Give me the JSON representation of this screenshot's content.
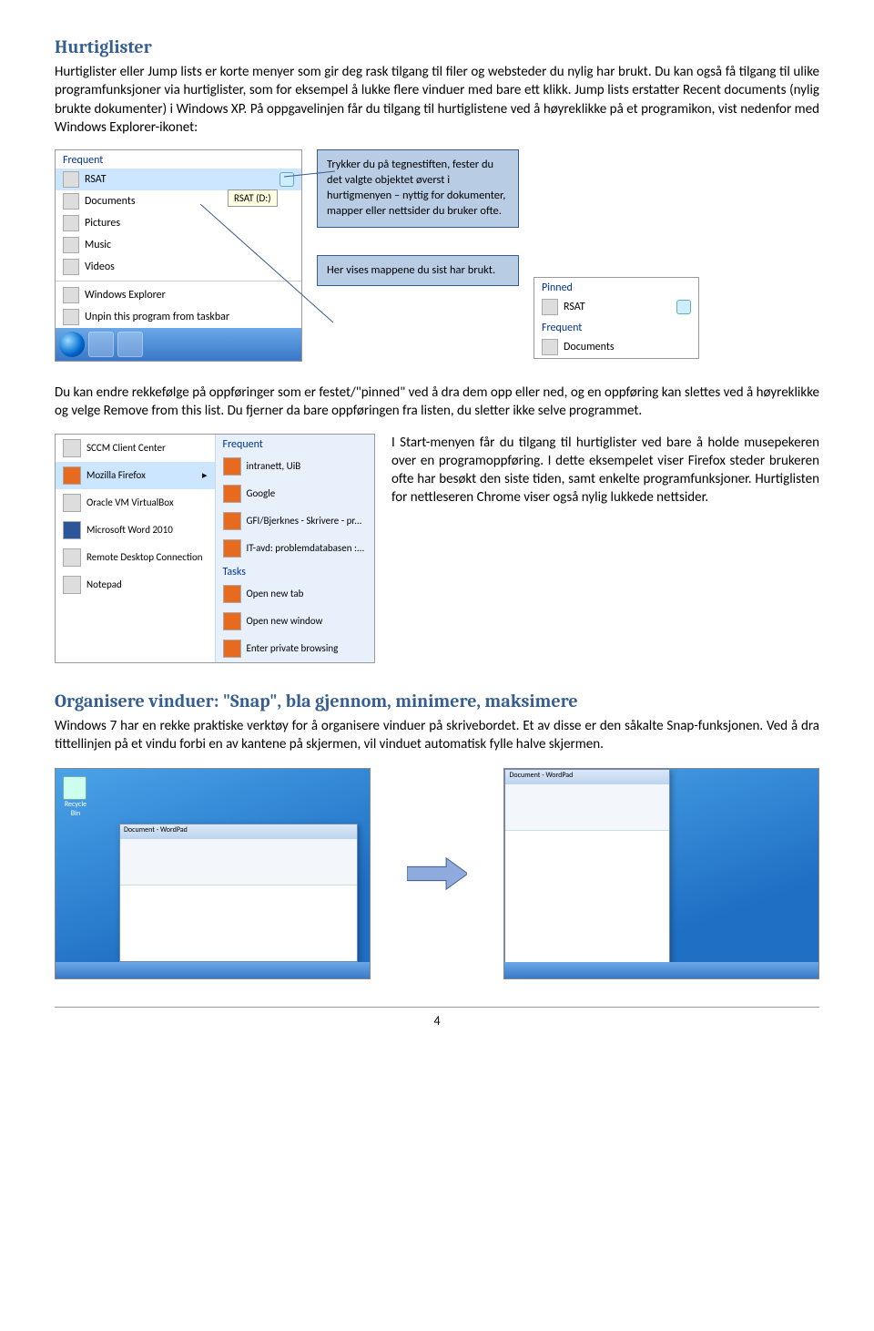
{
  "h1": "Hurtiglister",
  "p1": "Hurtiglister eller Jump lists er korte menyer som gir deg rask tilgang til filer og websteder du nylig har brukt. Du kan også få tilgang til ulike programfunksjoner via hurtiglister, som for eksempel å lukke flere vinduer med bare ett klikk. Jump lists erstatter Recent documents (nylig brukte dokumenter) i Windows XP. På oppgavelinjen får du tilgang til hurtiglistene ved å høyreklikke på et programikon, vist nedenfor med Windows Explorer-ikonet:",
  "jl1": {
    "hdr1": "Frequent",
    "items": [
      "RSAT",
      "Documents",
      "Pictures",
      "Music",
      "Videos"
    ],
    "hdr2": "",
    "actions": [
      "Windows Explorer",
      "Unpin this program from taskbar"
    ],
    "tooltip": "RSAT (D:)"
  },
  "call1": "Trykker du på tegnestiften, fester du det valgte objektet øverst i hurtigmenyen – nyttig for dokumenter, mapper eller nettsider du bruker ofte.",
  "call2": "Her vises mappene du sist har brukt.",
  "jl2": {
    "hdr1": "Pinned",
    "item1": "RSAT",
    "hdr2": "Frequent",
    "item2": "Documents"
  },
  "p2": "Du kan endre rekkefølge på oppføringer som er festet/\"pinned\" ved å dra dem opp eller ned, og en oppføring kan slettes ved å høyreklikke og velge Remove from this list. Du fjerner da bare oppføringen fra listen, du sletter ikke selve programmet.",
  "sm": {
    "left": [
      "SCCM Client Center",
      "Mozilla Firefox",
      "Oracle VM VirtualBox",
      "Microsoft Word 2010",
      "Remote Desktop Connection",
      "Notepad"
    ],
    "rhdr1": "Frequent",
    "right1": [
      "intranett, UiB",
      "Google",
      "GFI/Bjerknes - Skrivere - pr...",
      "IT-avd: problemdatabasen :..."
    ],
    "rhdr2": "Tasks",
    "right2": [
      "Open new tab",
      "Open new window",
      "Enter private browsing"
    ]
  },
  "p3": "I Start-menyen får du tilgang til hurtiglister ved bare å holde musepekeren over en programoppføring. I dette eksempelet viser Firefox steder brukeren ofte har besøkt den siste tiden, samt enkelte programfunksjoner. Hurtiglisten for nettleseren Chrome viser også nylig lukkede nettsider.",
  "h2": "Organisere vinduer: \"Snap\", bla gjennom, minimere, maksimere",
  "p4": "Windows 7 har en rekke praktiske verktøy for å organisere vinduer på skrivebordet. Et av disse er den såkalte Snap-funksjonen. Ved å dra tittellinjen på et vindu forbi en av kantene på skjermen, vil vinduet automatisk fylle halve skjermen.",
  "page": "4",
  "recycle": "Recycle Bin",
  "wp": "Document - WordPad"
}
